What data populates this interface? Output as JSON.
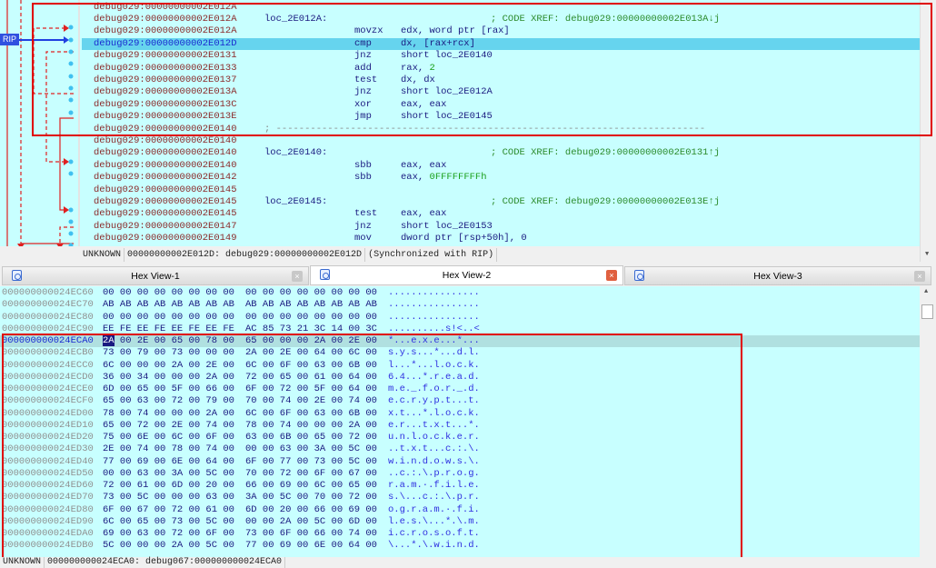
{
  "disassembly": {
    "rip_label": "RIP",
    "rows": [
      {
        "addr": "debug029:00000000002E012A",
        "label": "",
        "mn": "",
        "op": "",
        "cm": ""
      },
      {
        "addr": "debug029:00000000002E012A",
        "label": "loc_2E012A:",
        "mn": "",
        "op": "",
        "cm": "; CODE XREF: debug029:00000000002E013A↓j"
      },
      {
        "addr": "debug029:00000000002E012A",
        "label": "",
        "mn": "movzx",
        "op": "edx, word ptr [rax]",
        "cm": ""
      },
      {
        "addr": "debug029:00000000002E012D",
        "label": "",
        "mn": "cmp",
        "op": "dx, [rax+rcx]",
        "cm": "",
        "current": true
      },
      {
        "addr": "debug029:00000000002E0131",
        "label": "",
        "mn": "jnz",
        "op": "short loc_2E0140",
        "cm": ""
      },
      {
        "addr": "debug029:00000000002E0133",
        "label": "",
        "mn": "add",
        "op": "rax, ",
        "num": "2",
        "cm": ""
      },
      {
        "addr": "debug029:00000000002E0137",
        "label": "",
        "mn": "test",
        "op": "dx, dx",
        "cm": ""
      },
      {
        "addr": "debug029:00000000002E013A",
        "label": "",
        "mn": "jnz",
        "op": "short loc_2E012A",
        "cm": ""
      },
      {
        "addr": "debug029:00000000002E013C",
        "label": "",
        "mn": "xor",
        "op": "eax, eax",
        "cm": ""
      },
      {
        "addr": "debug029:00000000002E013E",
        "label": "",
        "mn": "jmp",
        "op": "short loc_2E0145",
        "cm": ""
      },
      {
        "addr": "debug029:00000000002E0140",
        "sep": "; ---------------------------------------------------------------------------",
        "label": "",
        "mn": "",
        "op": "",
        "cm": ""
      },
      {
        "addr": "debug029:00000000002E0140",
        "label": "",
        "mn": "",
        "op": "",
        "cm": ""
      },
      {
        "addr": "debug029:00000000002E0140",
        "label": "loc_2E0140:",
        "mn": "",
        "op": "",
        "cm": "; CODE XREF: debug029:00000000002E0131↑j"
      },
      {
        "addr": "debug029:00000000002E0140",
        "label": "",
        "mn": "sbb",
        "op": "eax, eax",
        "cm": ""
      },
      {
        "addr": "debug029:00000000002E0142",
        "label": "",
        "mn": "sbb",
        "op": "eax, ",
        "num": "0FFFFFFFFh",
        "cm": ""
      },
      {
        "addr": "debug029:00000000002E0145",
        "label": "",
        "mn": "",
        "op": "",
        "cm": ""
      },
      {
        "addr": "debug029:00000000002E0145",
        "label": "loc_2E0145:",
        "mn": "",
        "op": "",
        "cm": "; CODE XREF: debug029:00000000002E013E↑j"
      },
      {
        "addr": "debug029:00000000002E0145",
        "label": "",
        "mn": "test",
        "op": "eax, eax",
        "cm": ""
      },
      {
        "addr": "debug029:00000000002E0147",
        "label": "",
        "mn": "jnz",
        "op": "short loc_2E0153",
        "cm": ""
      },
      {
        "addr": "debug029:00000000002E0149",
        "label": "",
        "mn": "mov",
        "op": "dword ptr [rsp+50h], 0",
        "cm": ""
      }
    ],
    "status": [
      "UNKNOWN",
      "00000000002E012D: debug029:00000000002E012D",
      "(Synchronized with RIP)"
    ]
  },
  "tabs": [
    {
      "label": "Hex View-1",
      "active": false
    },
    {
      "label": "Hex View-2",
      "active": true
    },
    {
      "label": "Hex View-3",
      "active": false
    }
  ],
  "hex": {
    "rows": [
      {
        "a": "000000000024EC60",
        "b": "00 00 00 00 00 00 00 00",
        "c": "00 00 00 00 00 00 00 00",
        "s": "................"
      },
      {
        "a": "000000000024EC70",
        "b": "AB AB AB AB AB AB AB AB",
        "c": "AB AB AB AB AB AB AB AB",
        "s": "................"
      },
      {
        "a": "000000000024EC80",
        "b": "00 00 00 00 00 00 00 00",
        "c": "00 00 00 00 00 00 00 00",
        "s": "................"
      },
      {
        "a": "000000000024EC90",
        "b": "EE FE EE FE EE FE EE FE",
        "c": "AC 85 73 21 3C 14 00 3C",
        "s": "..........s!<..<"
      },
      {
        "a": "000000000024ECA0",
        "b": "2A 00 2E 00 65 00 78 00",
        "c": "65 00 00 00 2A 00 2E 00",
        "s": "*...e.x.e...*...",
        "current": true
      },
      {
        "a": "000000000024ECB0",
        "b": "73 00 79 00 73 00 00 00",
        "c": "2A 00 2E 00 64 00 6C 00",
        "s": "s.y.s...*...d.l."
      },
      {
        "a": "000000000024ECC0",
        "b": "6C 00 00 00 2A 00 2E 00",
        "c": "6C 00 6F 00 63 00 6B 00",
        "s": "l...*...l.o.c.k."
      },
      {
        "a": "000000000024ECD0",
        "b": "36 00 34 00 00 00 2A 00",
        "c": "72 00 65 00 61 00 64 00",
        "s": "6.4...*.r.e.a.d."
      },
      {
        "a": "000000000024ECE0",
        "b": "6D 00 65 00 5F 00 66 00",
        "c": "6F 00 72 00 5F 00 64 00",
        "s": "m.e._.f.o.r._.d."
      },
      {
        "a": "000000000024ECF0",
        "b": "65 00 63 00 72 00 79 00",
        "c": "70 00 74 00 2E 00 74 00",
        "s": "e.c.r.y.p.t...t."
      },
      {
        "a": "000000000024ED00",
        "b": "78 00 74 00 00 00 2A 00",
        "c": "6C 00 6F 00 63 00 6B 00",
        "s": "x.t...*.l.o.c.k."
      },
      {
        "a": "000000000024ED10",
        "b": "65 00 72 00 2E 00 74 00",
        "c": "78 00 74 00 00 00 2A 00",
        "s": "e.r...t.x.t...*."
      },
      {
        "a": "000000000024ED20",
        "b": "75 00 6E 00 6C 00 6F 00",
        "c": "63 00 6B 00 65 00 72 00",
        "s": "u.n.l.o.c.k.e.r."
      },
      {
        "a": "000000000024ED30",
        "b": "2E 00 74 00 78 00 74 00",
        "c": "00 00 63 00 3A 00 5C 00",
        "s": "..t.x.t...c.:.\\."
      },
      {
        "a": "000000000024ED40",
        "b": "77 00 69 00 6E 00 64 00",
        "c": "6F 00 77 00 73 00 5C 00",
        "s": "w.i.n.d.o.w.s.\\."
      },
      {
        "a": "000000000024ED50",
        "b": "00 00 63 00 3A 00 5C 00",
        "c": "70 00 72 00 6F 00 67 00",
        "s": "..c.:.\\.p.r.o.g."
      },
      {
        "a": "000000000024ED60",
        "b": "72 00 61 00 6D 00 20 00",
        "c": "66 00 69 00 6C 00 65 00",
        "s": "r.a.m.·.f.i.l.e."
      },
      {
        "a": "000000000024ED70",
        "b": "73 00 5C 00 00 00 63 00",
        "c": "3A 00 5C 00 70 00 72 00",
        "s": "s.\\...c.:.\\.p.r."
      },
      {
        "a": "000000000024ED80",
        "b": "6F 00 67 00 72 00 61 00",
        "c": "6D 00 20 00 66 00 69 00",
        "s": "o.g.r.a.m.·.f.i."
      },
      {
        "a": "000000000024ED90",
        "b": "6C 00 65 00 73 00 5C 00",
        "c": "00 00 2A 00 5C 00 6D 00",
        "s": "l.e.s.\\...*.\\.m."
      },
      {
        "a": "000000000024EDA0",
        "b": "69 00 63 00 72 00 6F 00",
        "c": "73 00 6F 00 66 00 74 00",
        "s": "i.c.r.o.s.o.f.t."
      },
      {
        "a": "000000000024EDB0",
        "b": "5C 00 00 00 2A 00 5C 00",
        "c": "77 00 69 00 6E 00 64 00",
        "s": "\\...*.\\.w.i.n.d."
      }
    ],
    "status": [
      "UNKNOWN",
      "000000000024ECA0: debug067:000000000024ECA0"
    ]
  },
  "colors": {
    "background": "#c8ffff",
    "highlight": "#66d4ee",
    "annotation": "#e00000"
  }
}
